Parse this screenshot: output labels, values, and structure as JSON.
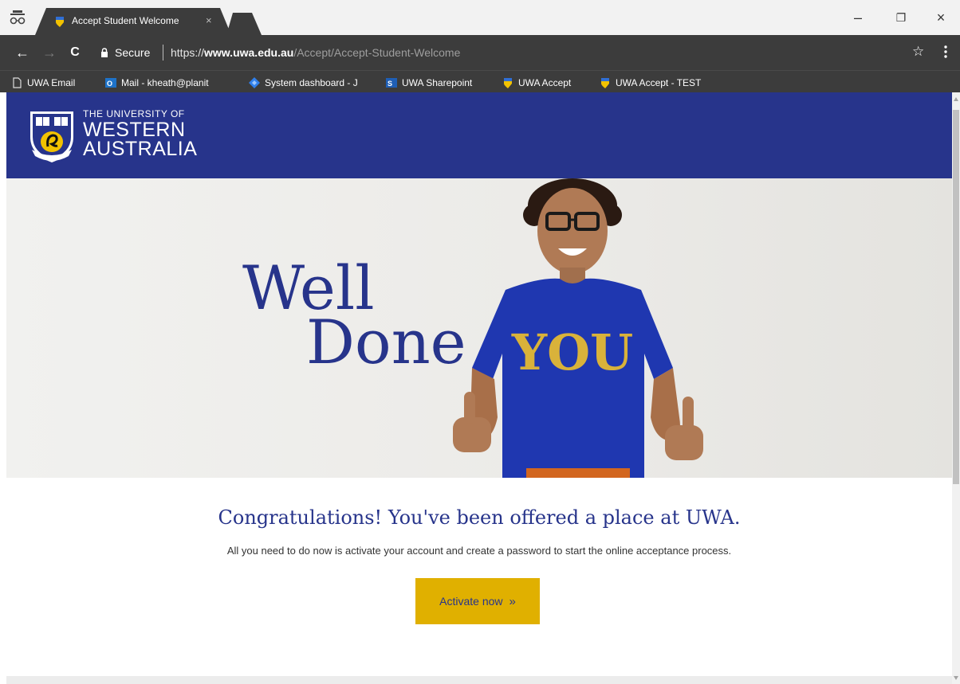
{
  "browser": {
    "tab": {
      "title": "Accept Student Welcome",
      "close_glyph": "×"
    },
    "controls": {
      "minimize": "–",
      "restore": "❐",
      "close": "×"
    },
    "nav": {
      "back": "←",
      "forward": "→",
      "reload": "C"
    },
    "address": {
      "security_label": "Secure",
      "url_scheme": "https://",
      "url_host": "www.uwa.edu.au",
      "url_path": "/Accept/Accept-Student-Welcome"
    },
    "bookmark_star": "☆",
    "bookmarks": [
      {
        "label": "UWA Email",
        "icon": "page-icon"
      },
      {
        "label": "Mail - kheath@planit",
        "icon": "outlook-icon"
      },
      {
        "label": "System dashboard - J",
        "icon": "jira-icon"
      },
      {
        "label": "UWA Sharepoint",
        "icon": "sharepoint-icon"
      },
      {
        "label": "UWA Accept",
        "icon": "uwa-crest-icon"
      },
      {
        "label": "UWA Accept - TEST",
        "icon": "uwa-crest-icon"
      }
    ]
  },
  "header": {
    "logo_line1": "THE UNIVERSITY OF",
    "logo_line2": "WESTERN",
    "logo_line3": "AUSTRALIA"
  },
  "hero": {
    "line1": "Well",
    "line2": "Done",
    "shirt_text": "YOU"
  },
  "main": {
    "heading": "Congratulations! You've been offered a place at UWA.",
    "body": "All you need to do now is activate your account and create a password to start the online acceptance process.",
    "cta_label": "Activate now",
    "cta_chevron": "»"
  },
  "colors": {
    "brand_blue": "#27348b",
    "brand_gold": "#e0b000",
    "chrome_dark": "#3c3c3c"
  }
}
